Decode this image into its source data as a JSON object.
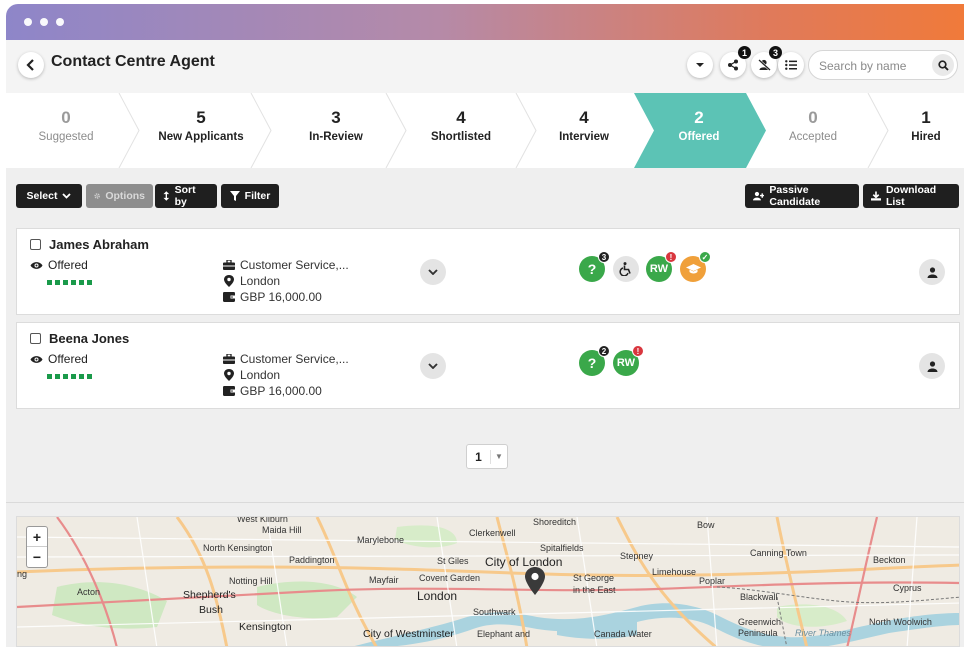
{
  "window": {
    "controls": [
      "dot",
      "dot",
      "dot"
    ]
  },
  "header": {
    "back_icon": "chevron-left-icon",
    "title": "Contact Centre Agent",
    "icons": [
      {
        "name": "dropdown-caret-icon",
        "badge": ""
      },
      {
        "name": "share-icon",
        "badge": "1"
      },
      {
        "name": "user-slash-icon",
        "badge": "3"
      },
      {
        "name": "list-icon",
        "badge": ""
      }
    ],
    "search": {
      "placeholder": "Search by name",
      "value": ""
    }
  },
  "pipeline": {
    "active_color": "#5cc3b5",
    "stages": [
      {
        "count": "0",
        "label": "Suggested",
        "state": "muted"
      },
      {
        "count": "5",
        "label": "New Applicants",
        "state": "normal"
      },
      {
        "count": "3",
        "label": "In-Review",
        "state": "normal"
      },
      {
        "count": "4",
        "label": "Shortlisted",
        "state": "normal"
      },
      {
        "count": "4",
        "label": "Interview",
        "state": "normal"
      },
      {
        "count": "2",
        "label": "Offered",
        "state": "active"
      },
      {
        "count": "0",
        "label": "Accepted",
        "state": "muted"
      },
      {
        "count": "1",
        "label": "Hired",
        "state": "normal"
      }
    ]
  },
  "toolbar": {
    "select_label": "Select",
    "options_label": "Options",
    "sortby_label": "Sort by",
    "filter_label": "Filter",
    "passive_label": "Passive Candidate",
    "download_label": "Download List"
  },
  "candidates": [
    {
      "name": "James Abraham",
      "status": "Offered",
      "progress_steps": 6,
      "job": "Customer Service,...",
      "location": "London",
      "salary": "GBP 16,000.00",
      "badges": [
        {
          "type": "question",
          "text": "?",
          "color": "#3aa84a",
          "badge": "3",
          "badge_color": "#222"
        },
        {
          "type": "accessibility",
          "text": "♿",
          "color": "#e4e4e4"
        },
        {
          "type": "rw",
          "text": "RW",
          "color": "#3aa84a",
          "badge": "!",
          "badge_color": "#d9363e"
        },
        {
          "type": "education",
          "text": "🎓",
          "color": "#f0a03a",
          "badge": "✓",
          "badge_color": "#3aa84a"
        }
      ]
    },
    {
      "name": "Beena Jones",
      "status": "Offered",
      "progress_steps": 6,
      "job": "Customer Service,...",
      "location": "London",
      "salary": "GBP 16,000.00",
      "badges": [
        {
          "type": "question",
          "text": "?",
          "color": "#3aa84a",
          "badge": "2",
          "badge_color": "#222"
        },
        {
          "type": "rw",
          "text": "RW",
          "color": "#3aa84a",
          "badge": "!",
          "badge_color": "#d9363e"
        }
      ]
    }
  ],
  "pagination": {
    "page": "1"
  },
  "map": {
    "zoom_in": "+",
    "zoom_out": "−",
    "labels": {
      "west_kilburn": "West Kilburn",
      "maida_hill": "Maida Hill",
      "marylebone": "Marylebone",
      "clerkenwell": "Clerkenwell",
      "shoreditch": "Shoreditch",
      "bow": "Bow",
      "north_kensington": "North Kensington",
      "paddington": "Paddington",
      "spitalfields": "Spitalfields",
      "stepney": "Stepney",
      "canning_town": "Canning Town",
      "beckton": "Beckton",
      "notting_hill": "Notting Hill",
      "mayfair": "Mayfair",
      "st_giles": "St Giles",
      "city_of_london": "City of London",
      "limehouse": "Limehouse",
      "acton": "Acton",
      "covent_garden": "Covent Garden",
      "st_george": "St George",
      "in_the_east": "in the East",
      "poplar": "Poplar",
      "shepherds": "Shepherd's",
      "bush": "Bush",
      "london": "London",
      "blackwall": "Blackwall",
      "cyprus": "Cyprus",
      "southwark": "Southwark",
      "kensington": "Kensington",
      "city_of_westminster": "City of Westminster",
      "elephant_and": "Elephant and",
      "canada_water": "Canada Water",
      "greenwich": "Greenwich",
      "peninsula": "Peninsula",
      "river_thames": "River Thames",
      "north_woolwich": "North Woolwich",
      "ng": "ng"
    }
  }
}
